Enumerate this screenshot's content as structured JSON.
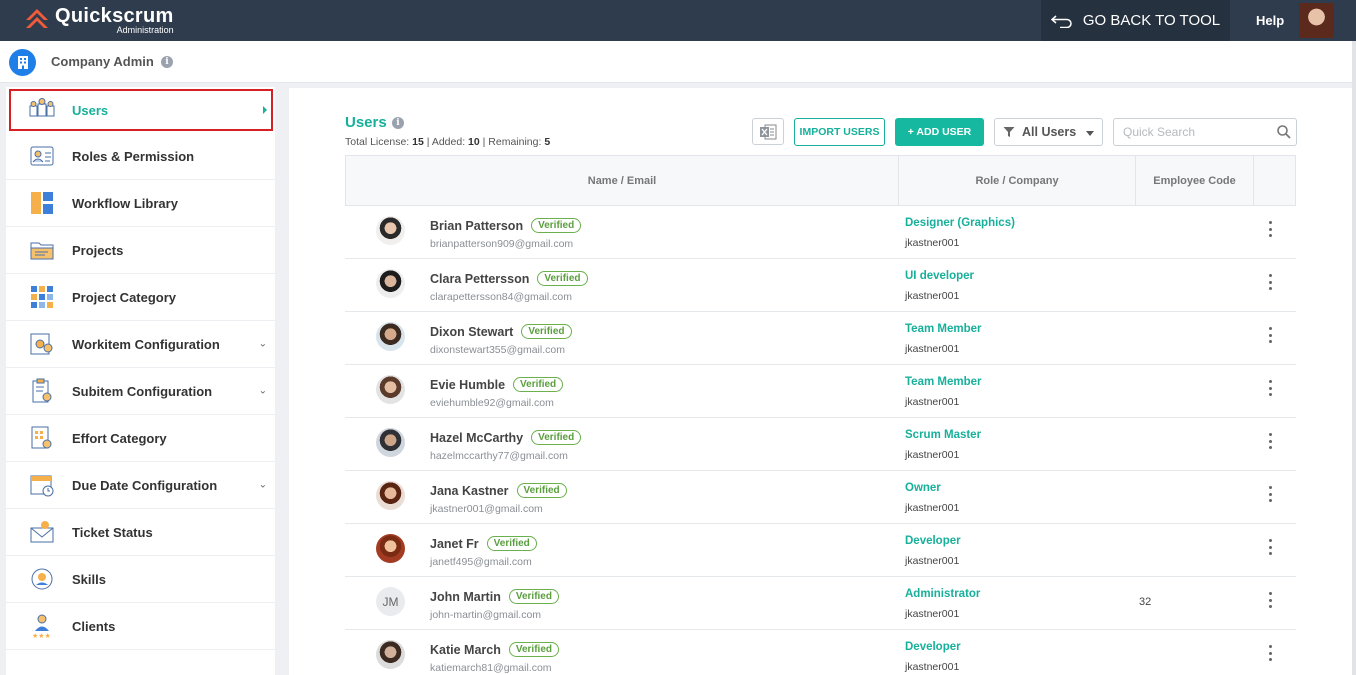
{
  "app": {
    "logo_title": "Quickscrum",
    "logo_sub": "Administration",
    "go_back": "GO BACK TO TOOL",
    "help": "Help"
  },
  "subheader": {
    "title": "Company Admin"
  },
  "sidebar": {
    "items": [
      {
        "label": "Users",
        "icon": "users-icon",
        "active": true
      },
      {
        "label": "Roles & Permission",
        "icon": "id-card-icon"
      },
      {
        "label": "Workflow Library",
        "icon": "workflow-icon"
      },
      {
        "label": "Projects",
        "icon": "folder-icon"
      },
      {
        "label": "Project Category",
        "icon": "grid-icon"
      },
      {
        "label": "Workitem Configuration",
        "icon": "gears-icon",
        "expandable": true
      },
      {
        "label": "Subitem Configuration",
        "icon": "clipboard-gear-icon",
        "expandable": true
      },
      {
        "label": "Effort Category",
        "icon": "doc-gear-icon"
      },
      {
        "label": "Due Date Configuration",
        "icon": "calendar-clock-icon",
        "expandable": true
      },
      {
        "label": "Ticket Status",
        "icon": "ticket-mail-icon"
      },
      {
        "label": "Skills",
        "icon": "skills-icon"
      },
      {
        "label": "Clients",
        "icon": "client-icon"
      }
    ]
  },
  "main": {
    "title": "Users",
    "license": {
      "total_label": "Total License:",
      "total": "15",
      "added_label": "Added:",
      "added": "10",
      "remaining_label": "Remaining:",
      "remaining": "5",
      "sep": "|"
    },
    "import_label": "IMPORT USERS",
    "add_label": "+ ADD USER",
    "filter_value": "All Users",
    "search_placeholder": "Quick Search",
    "columns": [
      "Name / Email",
      "Role / Company",
      "Employee Code"
    ],
    "users": [
      {
        "name": "Brian Patterson",
        "email": "brianpatterson909@gmail.com",
        "role": "Designer (Graphics)",
        "company": "jkastner001",
        "code": "",
        "status": "Verified",
        "avatar": "photo"
      },
      {
        "name": "Clara Pettersson",
        "email": "clarapettersson84@gmail.com",
        "role": "UI developer",
        "company": "jkastner001",
        "code": "",
        "status": "Verified",
        "avatar": "photo"
      },
      {
        "name": "Dixon Stewart",
        "email": "dixonstewart355@gmail.com",
        "role": "Team Member",
        "company": "jkastner001",
        "code": "",
        "status": "Verified",
        "avatar": "photo"
      },
      {
        "name": "Evie Humble",
        "email": "eviehumble92@gmail.com",
        "role": "Team Member",
        "company": "jkastner001",
        "code": "",
        "status": "Verified",
        "avatar": "photo"
      },
      {
        "name": "Hazel McCarthy",
        "email": "hazelmccarthy77@gmail.com",
        "role": "Scrum Master",
        "company": "jkastner001",
        "code": "",
        "status": "Verified",
        "avatar": "photo"
      },
      {
        "name": "Jana Kastner",
        "email": "jkastner001@gmail.com",
        "role": "Owner",
        "company": "jkastner001",
        "code": "",
        "status": "Verified",
        "avatar": "photo"
      },
      {
        "name": "Janet Fr",
        "email": "janetf495@gmail.com",
        "role": "Developer",
        "company": "jkastner001",
        "code": "",
        "status": "Verified",
        "avatar": "photo"
      },
      {
        "name": "John Martin",
        "email": "john-martin@gmail.com",
        "role": "Administrator",
        "company": "jkastner001",
        "code": "32",
        "status": "Verified",
        "avatar": "JM"
      },
      {
        "name": "Katie March",
        "email": "katiemarch81@gmail.com",
        "role": "Developer",
        "company": "jkastner001",
        "code": "",
        "status": "Verified",
        "avatar": "photo"
      }
    ]
  },
  "colors": {
    "topbar": "#2f3c4d",
    "accent": "#17b09b",
    "active_border": "#d71f24",
    "verified": "#5a9e3e"
  }
}
